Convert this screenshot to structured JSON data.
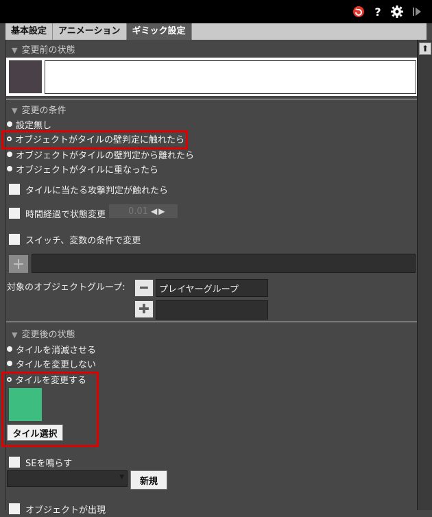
{
  "tabs": [
    "基本設定",
    "アニメーション",
    "ギミック設定"
  ],
  "active_tab": "ギミック設定",
  "before": {
    "header": "変更前の状態"
  },
  "condition": {
    "header": "変更の条件",
    "options": [
      "設定無し",
      "オブジェクトがタイルの壁判定に触れたら",
      "オブジェクトがタイルの壁判定から離れたら",
      "オブジェクトがタイルに重なったら"
    ],
    "selected_index": 1,
    "checkboxes": {
      "attack": "タイルに当たる攻撃判定が触れたら",
      "time": "時間経過で状態変更",
      "switch": "スイッチ、変数の条件で変更"
    },
    "time_value": "0.01",
    "object_group_label": "対象のオブジェクトグループ:",
    "object_group_value": "プレイヤーグループ"
  },
  "after": {
    "header": "変更後の状態",
    "options": [
      "タイルを消滅させる",
      "タイルを変更しない",
      "タイルを変更する"
    ],
    "selected_index": 2,
    "tile_button": "タイル選択",
    "tile_color": "#3dbe80"
  },
  "se": {
    "label": "SEを鳴らす",
    "new_button": "新規"
  },
  "object_spawn": {
    "label": "オブジェクトが出現"
  },
  "colors": {
    "highlight": "#e00000",
    "before_tile": "#4a4048"
  }
}
